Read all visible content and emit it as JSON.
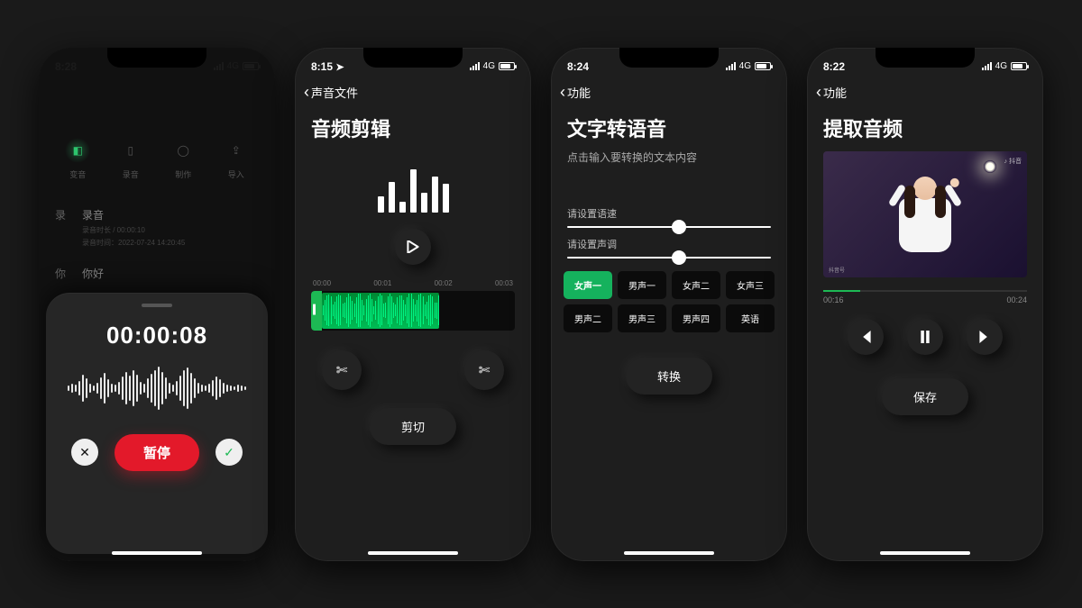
{
  "phones": [
    {
      "status": {
        "time": "8:28",
        "net": "4G"
      },
      "segments": [
        "变音",
        "录音",
        "制作",
        "导入"
      ],
      "list": [
        {
          "tag": "录",
          "name": "录音",
          "meta1": "录音时长 / 00:00:10",
          "meta2": "录音时间：2022-07-24 14:20:45"
        },
        {
          "tag": "你",
          "name": "你好",
          "meta1": "",
          "meta2": ""
        }
      ],
      "timer": "00:00:08",
      "pause_label": "暂停"
    },
    {
      "status": {
        "time": "8:15",
        "net": "4G"
      },
      "back": "声音文件",
      "title": "音频剪辑",
      "ruler": [
        "00:00",
        "00:01",
        "00:02",
        "00:03"
      ],
      "cut_label": "剪切"
    },
    {
      "status": {
        "time": "8:24",
        "net": "4G"
      },
      "back": "功能",
      "title": "文字转语音",
      "placeholder": "点击输入要转换的文本内容",
      "speed_label": "请设置语速",
      "pitch_label": "请设置声调",
      "voices": [
        "女声一",
        "男声一",
        "女声二",
        "女声三",
        "男声二",
        "男声三",
        "男声四",
        "英语"
      ],
      "voice_active": 0,
      "convert_label": "转换"
    },
    {
      "status": {
        "time": "8:22",
        "net": "4G"
      },
      "back": "功能",
      "title": "提取音频",
      "watermark": "♪ 抖音",
      "watermark_bottom": "抖音号",
      "progress_pct": 18,
      "elapsed": "00:16",
      "total": "00:24",
      "save_label": "保存"
    }
  ]
}
